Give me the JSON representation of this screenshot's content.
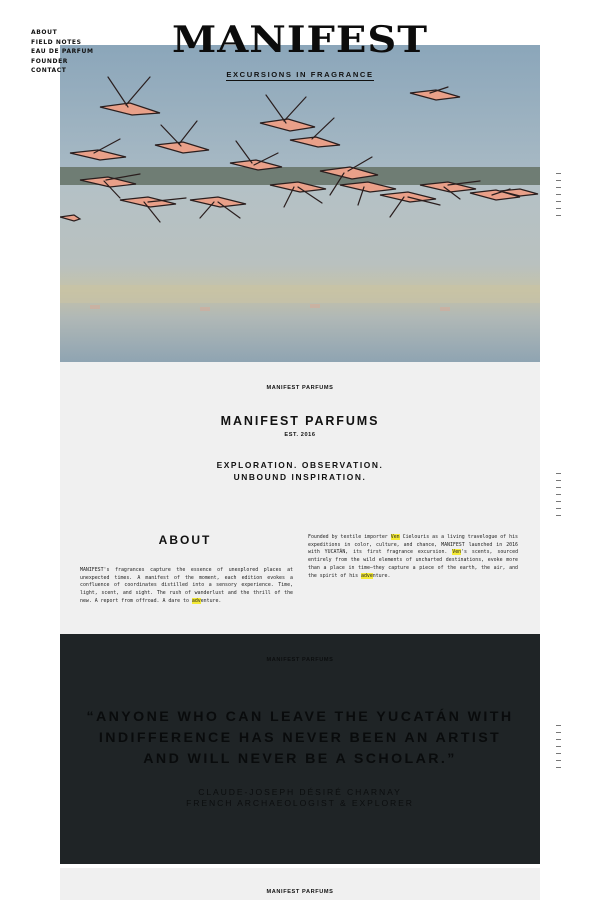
{
  "nav": {
    "items": [
      "ABOUT",
      "FIELD NOTES",
      "EAU DE PARFUM",
      "FOUNDER",
      "CONTACT"
    ]
  },
  "brand": {
    "logo": "MANIFEST",
    "tagline": "EXCURSIONS IN FRAGRANCE"
  },
  "hero": {
    "image": "flamingos-in-flight-photo",
    "colors": {
      "sky": "#8fa8b8",
      "water": "#b5c0c2",
      "flamingo": "#e9a089"
    }
  },
  "intro": {
    "label": "MANIFEST PARFUMS",
    "title": "MANIFEST PARFUMS",
    "established": "EST. 2016",
    "tagline_line1": "EXPLORATION. OBSERVATION.",
    "tagline_line2": "UNBOUND INSPIRATION.",
    "about_heading": "ABOUT",
    "about_left": {
      "text": "MANIFEST's fragrances capture the essence of unexplored places at unexpected times. A manifest of the moment, each edition evokes a confluence of coordinates distilled into a sensory experience. Time, light, scent, and sight. The rush of wanderlust and the thrill of the new. A report from offroad. A dare to ",
      "hl": "adv",
      "tail": "enture."
    },
    "about_right": {
      "p1": "Founded by textile importer ",
      "hl1": "Ven",
      "p2": " Cielouris as a living travelogue of his expeditions in color, culture, and chance, MANIFEST launched in 2016 with YUCATÁN, its first fragrance excursion. ",
      "hl2": "Ven",
      "p3": "'s scents, sourced entirely from the wild elements of uncharted destinations, evoke more than a place in time—they capture a piece of the earth, the air, and the spirit of his ",
      "hl3": "adve",
      "p4": "nture."
    }
  },
  "quote_section": {
    "label": "MANIFEST PARFUMS",
    "quote": "“ANYONE WHO CAN LEAVE THE YUCATÁN WITH INDIFFERENCE HAS NEVER BEEN AN ARTIST AND WILL NEVER BE A SCHOLAR.”",
    "author": "CLAUDE-JOSEPH DÉSIRÉ CHARNAY",
    "author_title": "FRENCH ARCHAEOLOGIST & EXPLORER"
  },
  "bottom_section": {
    "label": "MANIFEST PARFUMS"
  }
}
